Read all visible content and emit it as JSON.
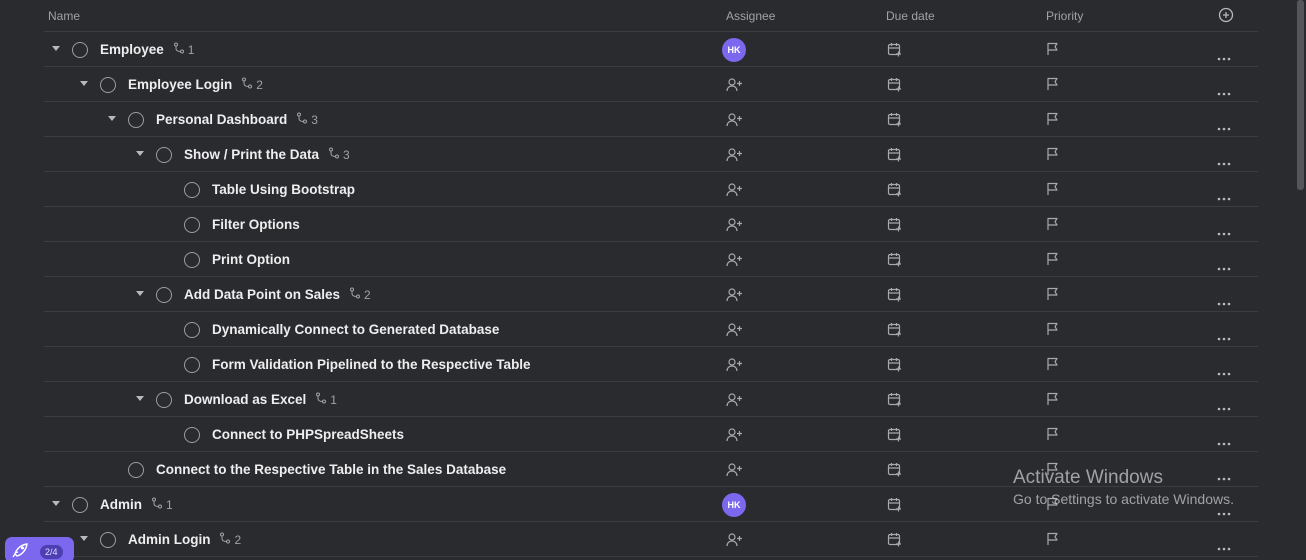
{
  "columns": {
    "name": "Name",
    "assignee": "Assignee",
    "due_date": "Due date",
    "priority": "Priority"
  },
  "rows": [
    {
      "title": "Employee",
      "level": 0,
      "expanded": true,
      "subtasks": "1",
      "assignee": "HK"
    },
    {
      "title": "Employee Login",
      "level": 1,
      "expanded": true,
      "subtasks": "2",
      "assignee": ""
    },
    {
      "title": "Personal Dashboard",
      "level": 2,
      "expanded": true,
      "subtasks": "3",
      "assignee": ""
    },
    {
      "title": "Show / Print the Data",
      "level": 3,
      "expanded": true,
      "subtasks": "3",
      "assignee": ""
    },
    {
      "title": "Table Using Bootstrap",
      "level": 4,
      "expanded": false,
      "subtasks": "",
      "assignee": ""
    },
    {
      "title": "Filter Options",
      "level": 4,
      "expanded": false,
      "subtasks": "",
      "assignee": ""
    },
    {
      "title": "Print Option",
      "level": 4,
      "expanded": false,
      "subtasks": "",
      "assignee": ""
    },
    {
      "title": "Add Data Point on Sales",
      "level": 3,
      "expanded": true,
      "subtasks": "2",
      "assignee": ""
    },
    {
      "title": "Dynamically Connect to Generated Database",
      "level": 4,
      "expanded": false,
      "subtasks": "",
      "assignee": ""
    },
    {
      "title": "Form Validation Pipelined to the Respective Table",
      "level": 4,
      "expanded": false,
      "subtasks": "",
      "assignee": ""
    },
    {
      "title": "Download as Excel",
      "level": 3,
      "expanded": true,
      "subtasks": "1",
      "assignee": ""
    },
    {
      "title": "Connect to PHPSpreadSheets",
      "level": 4,
      "expanded": false,
      "subtasks": "",
      "assignee": ""
    },
    {
      "title": "Connect to the Respective Table in the Sales Database",
      "level": 2,
      "expanded": false,
      "subtasks": "",
      "assignee": ""
    },
    {
      "title": "Admin",
      "level": 0,
      "expanded": true,
      "subtasks": "1",
      "assignee": "HK"
    },
    {
      "title": "Admin Login",
      "level": 1,
      "expanded": true,
      "subtasks": "2",
      "assignee": ""
    }
  ],
  "watermark": {
    "title": "Activate Windows",
    "subtitle": "Go to Settings to activate Windows."
  },
  "badge": {
    "count": "2/4"
  },
  "colors": {
    "accent": "#7b68ee",
    "background": "#2a2b2e",
    "divider": "#3c3d41"
  },
  "icons": {
    "add_column": "plus-circle-icon",
    "subtask": "subtask-icon",
    "add_assignee": "add-user-icon",
    "due_date": "calendar-icon",
    "priority": "flag-icon",
    "more": "more-horizontal-icon",
    "launcher": "rocket-icon"
  }
}
